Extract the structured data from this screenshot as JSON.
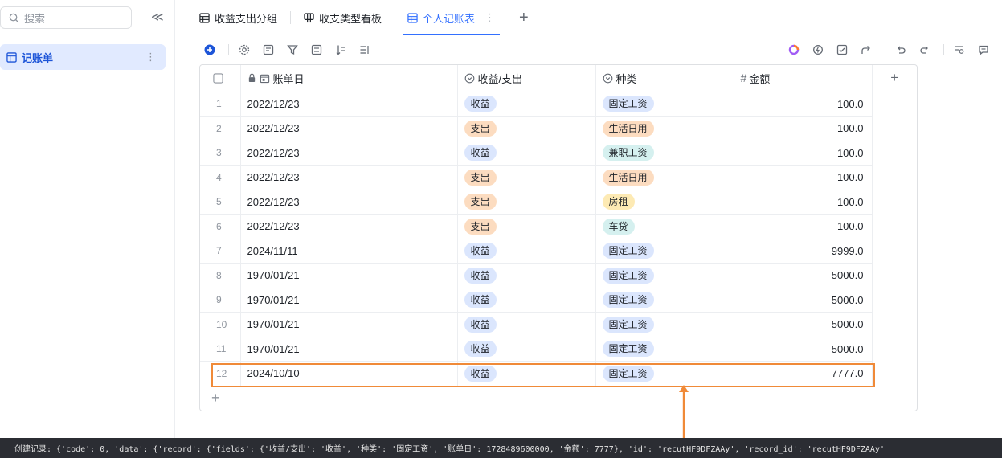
{
  "sidebar": {
    "search_placeholder": "搜索",
    "collapse": "≪",
    "items": [
      {
        "label": "记账单",
        "more": "⋮"
      }
    ]
  },
  "tabs": [
    {
      "label": "收益支出分组",
      "icon": "grid-table-icon"
    },
    {
      "label": "收支类型看板",
      "icon": "kanban-icon"
    },
    {
      "label": "个人记账表",
      "icon": "grid-table-icon",
      "active": true
    }
  ],
  "tab_more": "⋮",
  "tab_add": "+",
  "table": {
    "columns": [
      {
        "label": "账单日",
        "icon": "calendar-icon",
        "locked": true
      },
      {
        "label": "收益/支出",
        "icon": "single-select-icon"
      },
      {
        "label": "种类",
        "icon": "single-select-icon"
      },
      {
        "label": "金额",
        "icon": "hash-icon"
      }
    ],
    "add_column": "+",
    "add_row": "+",
    "rows": [
      {
        "n": "1",
        "date": "2022/12/23",
        "type": "收益",
        "cat": "固定工资",
        "amt": "100.0"
      },
      {
        "n": "2",
        "date": "2022/12/23",
        "type": "支出",
        "cat": "生活日用",
        "amt": "100.0"
      },
      {
        "n": "3",
        "date": "2022/12/23",
        "type": "收益",
        "cat": "兼职工资",
        "amt": "100.0"
      },
      {
        "n": "4",
        "date": "2022/12/23",
        "type": "支出",
        "cat": "生活日用",
        "amt": "100.0"
      },
      {
        "n": "5",
        "date": "2022/12/23",
        "type": "支出",
        "cat": "房租",
        "amt": "100.0"
      },
      {
        "n": "6",
        "date": "2022/12/23",
        "type": "支出",
        "cat": "车贷",
        "amt": "100.0"
      },
      {
        "n": "7",
        "date": "2024/11/11",
        "type": "收益",
        "cat": "固定工资",
        "amt": "9999.0"
      },
      {
        "n": "8",
        "date": "1970/01/21",
        "type": "收益",
        "cat": "固定工资",
        "amt": "5000.0"
      },
      {
        "n": "9",
        "date": "1970/01/21",
        "type": "收益",
        "cat": "固定工资",
        "amt": "5000.0"
      },
      {
        "n": "10",
        "date": "1970/01/21",
        "type": "收益",
        "cat": "固定工资",
        "amt": "5000.0"
      },
      {
        "n": "11",
        "date": "1970/01/21",
        "type": "收益",
        "cat": "固定工资",
        "amt": "5000.0"
      },
      {
        "n": "12",
        "date": "2024/10/10",
        "type": "收益",
        "cat": "固定工资",
        "amt": "7777.0"
      }
    ]
  },
  "colors": {
    "accent": "#3370ff",
    "highlight": "#f08a38",
    "console_bg": "#2b2d33"
  },
  "console": {
    "text": "创建记录: {'code': 0, 'data': {'record': {'fields': {'收益/支出': '收益', '种类': '固定工资', '账单日': 1728489600000, '金额': 7777}, 'id': 'recutHF9DFZAAy', 'record_id': 'recutHF9DFZAAy'"
  }
}
